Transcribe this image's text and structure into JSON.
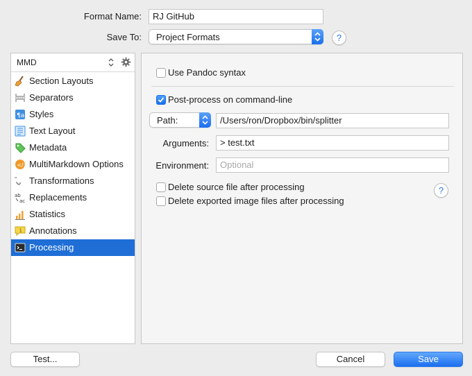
{
  "form": {
    "format_name_label": "Format Name:",
    "format_name_value": "RJ GitHub",
    "save_to_label": "Save To:",
    "save_to_value": "Project Formats",
    "help_glyph": "?"
  },
  "sidebar": {
    "selector_value": "MMD",
    "items": [
      {
        "label": "Section Layouts",
        "icon": "broom-icon"
      },
      {
        "label": "Separators",
        "icon": "separators-icon"
      },
      {
        "label": "Styles",
        "icon": "styles-icon"
      },
      {
        "label": "Text Layout",
        "icon": "text-layout-icon"
      },
      {
        "label": "Metadata",
        "icon": "tag-icon"
      },
      {
        "label": "MultiMarkdown Options",
        "icon": "code-icon"
      },
      {
        "label": "Transformations",
        "icon": "transformations-icon"
      },
      {
        "label": "Replacements",
        "icon": "replacements-icon"
      },
      {
        "label": "Statistics",
        "icon": "bar-chart-icon"
      },
      {
        "label": "Annotations",
        "icon": "note-icon"
      },
      {
        "label": "Processing",
        "icon": "terminal-icon",
        "selected": true
      }
    ]
  },
  "panel": {
    "use_pandoc_label": "Use Pandoc syntax",
    "use_pandoc_checked": false,
    "post_process_label": "Post-process on command-line",
    "post_process_checked": true,
    "path_popup_value": "Path:",
    "path_value": "/Users/ron/Dropbox/bin/splitter",
    "arguments_label": "Arguments:",
    "arguments_value": "> test.txt",
    "environment_label": "Environment:",
    "environment_placeholder": "Optional",
    "delete_source_label": "Delete source file after processing",
    "delete_source_checked": false,
    "delete_images_label": "Delete exported image files after processing",
    "delete_images_checked": false
  },
  "footer": {
    "test_label": "Test...",
    "cancel_label": "Cancel",
    "save_label": "Save"
  },
  "colors": {
    "accent": "#1e6ed6",
    "selection": "#1e6ed6"
  }
}
